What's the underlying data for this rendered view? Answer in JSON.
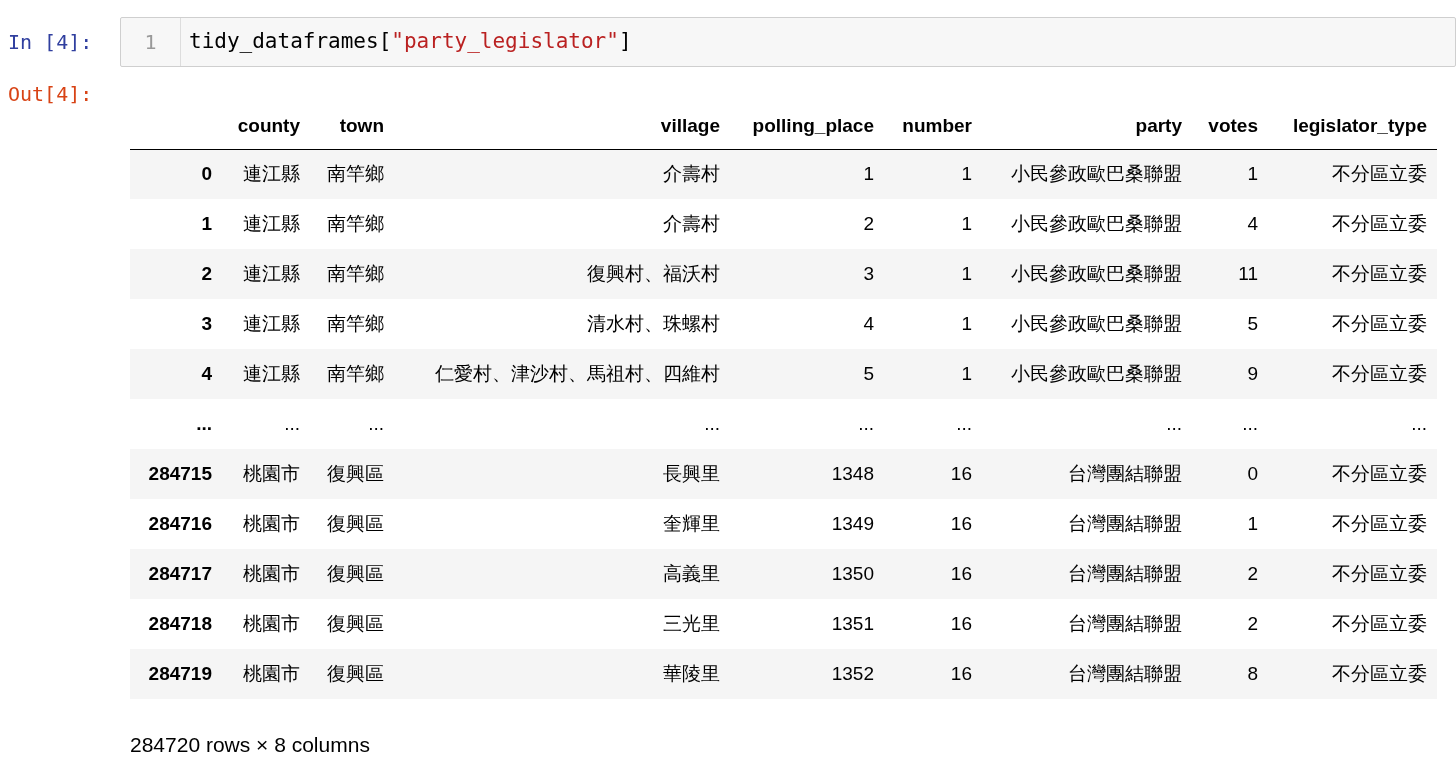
{
  "input_prompt": "In [4]:",
  "line_number": "1",
  "code": [
    {
      "kind": "name",
      "text": "tidy_dataframes"
    },
    {
      "kind": "punct",
      "text": "["
    },
    {
      "kind": "string",
      "text": "\"party_legislator\""
    },
    {
      "kind": "punct",
      "text": "]"
    }
  ],
  "output_prompt": "Out[4]:",
  "table": {
    "columns": [
      "county",
      "town",
      "village",
      "polling_place",
      "number",
      "party",
      "votes",
      "legislator_type"
    ],
    "rows": [
      {
        "index": "0",
        "cells": [
          "連江縣",
          "南竿鄉",
          "介壽村",
          "1",
          "1",
          "小民參政歐巴桑聯盟",
          "1",
          "不分區立委"
        ]
      },
      {
        "index": "1",
        "cells": [
          "連江縣",
          "南竿鄉",
          "介壽村",
          "2",
          "1",
          "小民參政歐巴桑聯盟",
          "4",
          "不分區立委"
        ]
      },
      {
        "index": "2",
        "cells": [
          "連江縣",
          "南竿鄉",
          "復興村、福沃村",
          "3",
          "1",
          "小民參政歐巴桑聯盟",
          "11",
          "不分區立委"
        ]
      },
      {
        "index": "3",
        "cells": [
          "連江縣",
          "南竿鄉",
          "清水村、珠螺村",
          "4",
          "1",
          "小民參政歐巴桑聯盟",
          "5",
          "不分區立委"
        ]
      },
      {
        "index": "4",
        "cells": [
          "連江縣",
          "南竿鄉",
          "仁愛村、津沙村、馬祖村、四維村",
          "5",
          "1",
          "小民參政歐巴桑聯盟",
          "9",
          "不分區立委"
        ]
      },
      {
        "index": "...",
        "cells": [
          "...",
          "...",
          "...",
          "...",
          "...",
          "...",
          "...",
          "..."
        ]
      },
      {
        "index": "284715",
        "cells": [
          "桃園市",
          "復興區",
          "長興里",
          "1348",
          "16",
          "台灣團結聯盟",
          "0",
          "不分區立委"
        ]
      },
      {
        "index": "284716",
        "cells": [
          "桃園市",
          "復興區",
          "奎輝里",
          "1349",
          "16",
          "台灣團結聯盟",
          "1",
          "不分區立委"
        ]
      },
      {
        "index": "284717",
        "cells": [
          "桃園市",
          "復興區",
          "高義里",
          "1350",
          "16",
          "台灣團結聯盟",
          "2",
          "不分區立委"
        ]
      },
      {
        "index": "284718",
        "cells": [
          "桃園市",
          "復興區",
          "三光里",
          "1351",
          "16",
          "台灣團結聯盟",
          "2",
          "不分區立委"
        ]
      },
      {
        "index": "284719",
        "cells": [
          "桃園市",
          "復興區",
          "華陵里",
          "1352",
          "16",
          "台灣團結聯盟",
          "8",
          "不分區立委"
        ]
      }
    ]
  },
  "summary": "284720 rows × 8 columns"
}
